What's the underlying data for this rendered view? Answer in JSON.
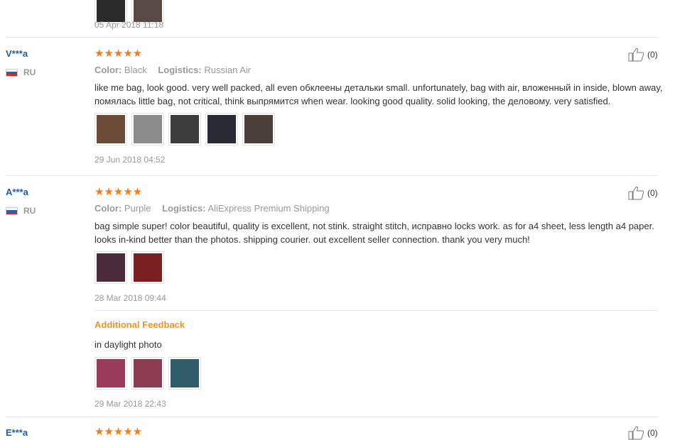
{
  "top_review": {
    "thumbs": [
      {
        "icon": "bag-photo-icon",
        "color": "#2b2b2b"
      },
      {
        "icon": "bag-photo-icon",
        "color": "#5a4a44"
      }
    ],
    "date": "05 Apr 2018 11:18"
  },
  "reviews": [
    {
      "user": "V***a",
      "country": "RU",
      "stars": "★★★★★",
      "color_label": "Color:",
      "color_value": "Black",
      "logistics_label": "Logistics:",
      "logistics_value": "Russian Air",
      "text": "like me bag, look good. very well packed, all even обклеены детальки small. unfortunately, bag with air, вложенный in inside, blown away, помялась little bag, not critical, think выпрямится when wear. looking good quality. solid looking, the деловому. very satisfied.",
      "helpful": "(0)",
      "thumbs": [
        {
          "icon": "bag-photo-icon",
          "color": "#6b4a36"
        },
        {
          "icon": "bag-photo-icon",
          "color": "#8c8c8c"
        },
        {
          "icon": "bag-photo-icon",
          "color": "#3d3d3d"
        },
        {
          "icon": "bag-photo-icon",
          "color": "#2a2a35"
        },
        {
          "icon": "bag-photo-icon",
          "color": "#4a3f3a"
        }
      ],
      "date": "29 Jun 2018 04:52"
    },
    {
      "user": "A***a",
      "country": "RU",
      "stars": "★★★★★",
      "color_label": "Color:",
      "color_value": "Purple",
      "logistics_label": "Logistics:",
      "logistics_value": "AliExpress Premium Shipping",
      "text": "bag simple super! color beautiful, quality is excellent, not stink. straight stitch, исправно locks work. as for a4 sheet, less length a4 paper. looks in-kind better than the photos. shipping courier. out excellent seller connection. thank you very much!",
      "helpful": "(0)",
      "thumbs": [
        {
          "icon": "bag-photo-icon",
          "color": "#4a2b3c"
        },
        {
          "icon": "bag-photo-icon",
          "color": "#7a1f22"
        }
      ],
      "date": "28 Mar 2018 09:44",
      "additional": {
        "title": "Additional Feedback",
        "text": "in daylight photo",
        "thumbs": [
          {
            "icon": "bag-photo-icon",
            "color": "#9a3b5c"
          },
          {
            "icon": "bag-photo-icon",
            "color": "#8d3d52"
          },
          {
            "icon": "bag-photo-icon",
            "color": "#2f5e6a"
          }
        ],
        "date": "29 Mar 2018 22:43"
      }
    }
  ],
  "next_review": {
    "user": "E***a",
    "stars": "★★★★★",
    "helpful": "(0)"
  },
  "colors": {
    "star": "#f47c1a",
    "username": "#1a5ea8",
    "additional_title": "#f0961e"
  }
}
